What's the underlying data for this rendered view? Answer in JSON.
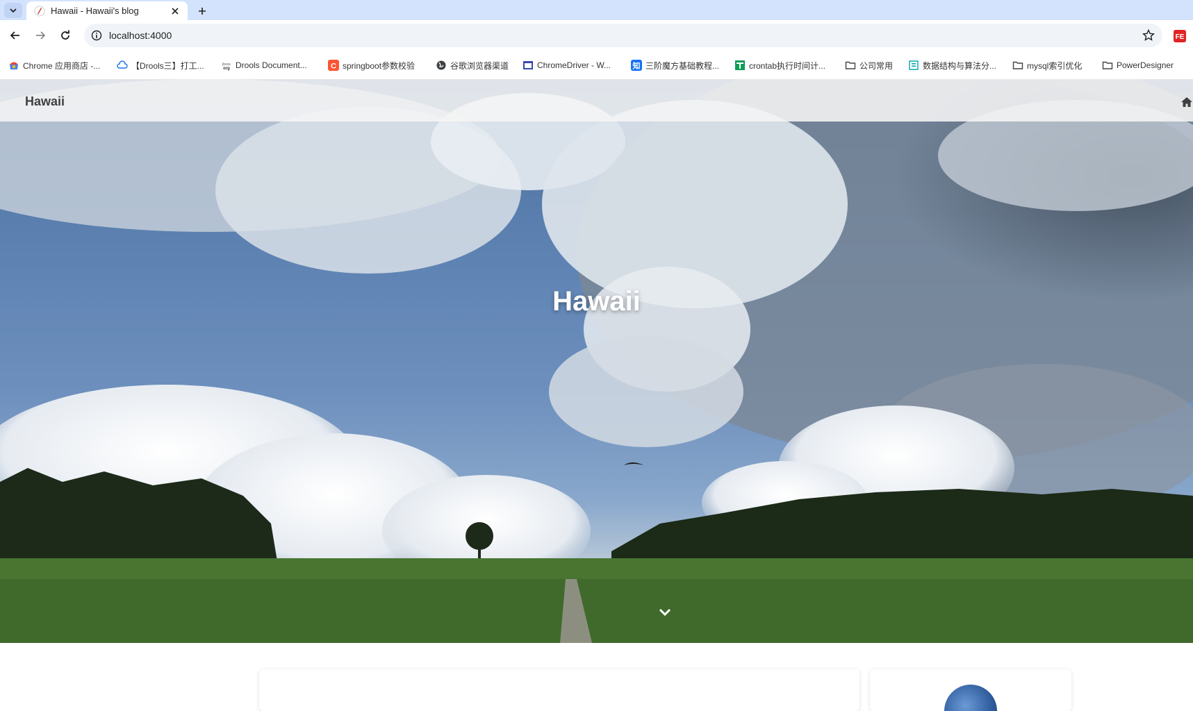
{
  "browser": {
    "tab": {
      "title": "Hawaii - Hawaii's blog"
    },
    "omnibox": {
      "url": "localhost:4000"
    },
    "bookmarks": [
      {
        "label": "Chrome 应用商店 -...",
        "icon": "chrome-webstore-icon"
      },
      {
        "label": "【Drools三】打工...",
        "icon": "cloud-icon"
      },
      {
        "label": "Drools Document...",
        "icon": "jboss-icon"
      },
      {
        "label": "springboot参数校验",
        "icon": "csdn-icon"
      },
      {
        "label": "谷歌浏览器渠道",
        "icon": "globe-icon"
      },
      {
        "label": "ChromeDriver - W...",
        "icon": "page-icon"
      },
      {
        "label": "三阶魔方基础教程...",
        "icon": "zhihu-icon"
      },
      {
        "label": "crontab执行时间计...",
        "icon": "table-icon"
      },
      {
        "label": "公司常用",
        "icon": "folder-icon"
      },
      {
        "label": "数据结构与算法分...",
        "icon": "book-icon"
      },
      {
        "label": "mysql索引优化",
        "icon": "folder-icon"
      },
      {
        "label": "PowerDesigner",
        "icon": "folder-icon"
      }
    ]
  },
  "site": {
    "brand": "Hawaii",
    "hero_title": "Hawaii",
    "home_icon": "home-icon",
    "scroll_icon": "chevron-down-icon"
  },
  "colors": {
    "tabstrip": "#d3e3fd",
    "omnibox": "#f0f4f9",
    "nav_bar": "#f5f5f5",
    "hero_text": "#ffffff"
  }
}
